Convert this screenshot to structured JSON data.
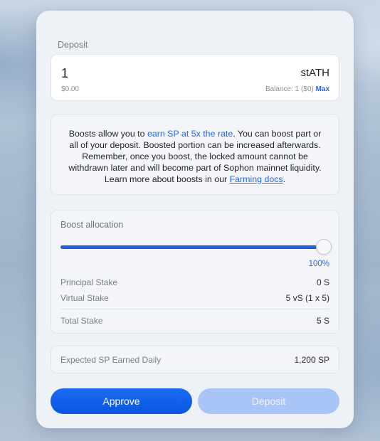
{
  "deposit": {
    "label": "Deposit",
    "amount": "1",
    "token": "stATH",
    "usd_value": "$0.00",
    "balance_text": "Balance: 1 ($0)",
    "max_label": "Max"
  },
  "info": {
    "text_1": "Boosts allow you to ",
    "highlight": "earn SP at 5x the rate",
    "text_2": ". You can boost part or all of your deposit. Boosted portion can be increased afterwards. Remember, once you boost, the locked amount cannot be withdrawn later and will become part of Sophon mainnet liquidity. Learn more about boosts in our ",
    "link": "Farming docs",
    "text_3": "."
  },
  "allocation": {
    "title": "Boost allocation",
    "percent": 100,
    "percent_label": "100%",
    "principal_label": "Principal Stake",
    "principal_value": "0 S",
    "virtual_label": "Virtual Stake",
    "virtual_value": "5 vS (1 x 5)",
    "total_label": "Total Stake",
    "total_value": "5 S"
  },
  "expected": {
    "label": "Expected SP Earned Daily",
    "value": "1,200 SP"
  },
  "buttons": {
    "approve": "Approve",
    "deposit": "Deposit"
  },
  "colors": {
    "accent": "#1f5fe0",
    "link": "#2566e8",
    "deposit_disabled": "#a9c4f7"
  }
}
